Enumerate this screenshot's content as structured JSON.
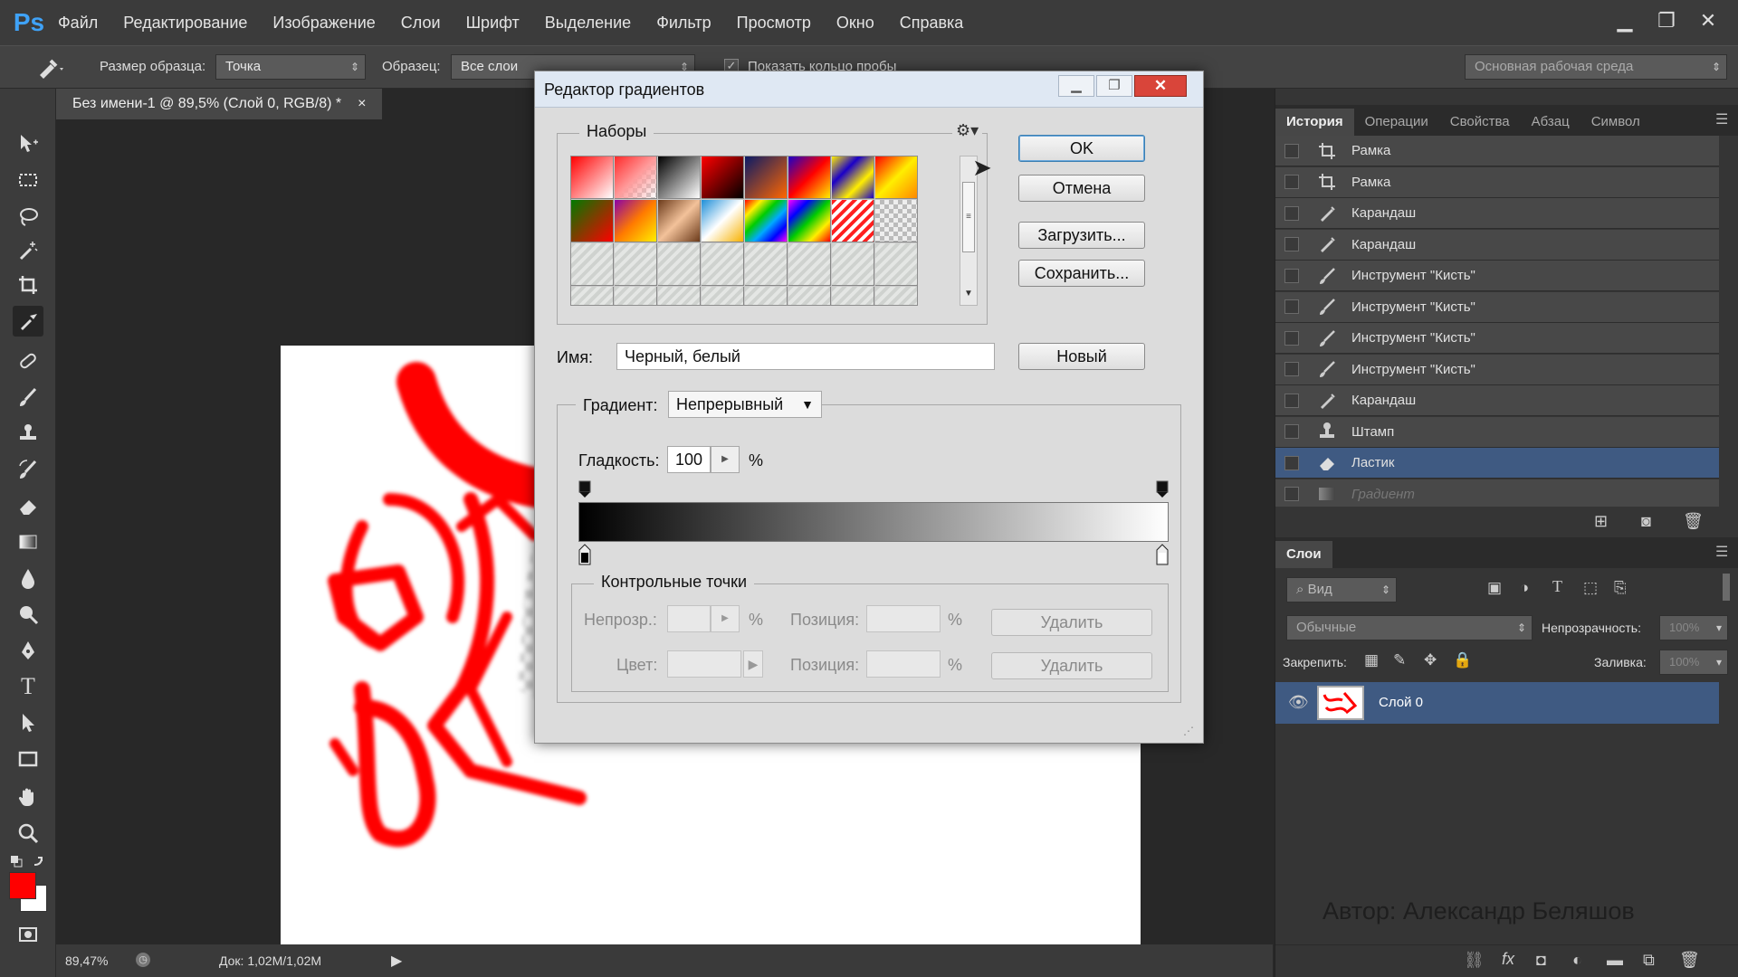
{
  "app": {
    "logo": "Ps"
  },
  "menubar": {
    "items": [
      "Файл",
      "Редактирование",
      "Изображение",
      "Слои",
      "Шрифт",
      "Выделение",
      "Фильтр",
      "Просмотр",
      "Окно",
      "Справка"
    ]
  },
  "options": {
    "sample_size_label": "Размер образца:",
    "sample_size_value": "Точка",
    "sample_label": "Образец:",
    "sample_value": "Все слои",
    "show_ring_label": "Показать кольцо пробы",
    "workspace": "Основная рабочая среда"
  },
  "document": {
    "tab_title": "Без имени-1 @ 89,5% (Слой 0, RGB/8) *",
    "close": "×"
  },
  "colors": {
    "foreground": "#ff0000",
    "background": "#ffffff",
    "accent": "#3fa2f7",
    "selection": "#3f5a82"
  },
  "status": {
    "zoom": "89,47%",
    "doc": "Док: 1,02M/1,02M"
  },
  "history_panel": {
    "tabs": [
      "История",
      "Операции",
      "Свойства",
      "Абзац",
      "Символ"
    ],
    "items": [
      {
        "label": "Рамка",
        "icon": "crop-icon"
      },
      {
        "label": "Рамка",
        "icon": "crop-icon"
      },
      {
        "label": "Карандаш",
        "icon": "pencil-icon"
      },
      {
        "label": "Карандаш",
        "icon": "pencil-icon"
      },
      {
        "label": "Инструмент \"Кисть\"",
        "icon": "brush-icon"
      },
      {
        "label": "Инструмент \"Кисть\"",
        "icon": "brush-icon"
      },
      {
        "label": "Инструмент \"Кисть\"",
        "icon": "brush-icon"
      },
      {
        "label": "Инструмент \"Кисть\"",
        "icon": "brush-icon"
      },
      {
        "label": "Карандаш",
        "icon": "pencil-icon"
      },
      {
        "label": "Штамп",
        "icon": "stamp-icon"
      },
      {
        "label": "Ластик",
        "icon": "eraser-icon",
        "selected": true
      },
      {
        "label": "Градиент",
        "icon": "gradient-icon",
        "dimmed": true
      }
    ]
  },
  "layers_panel": {
    "tab": "Слои",
    "filter": "Вид",
    "blend_mode": "Обычные",
    "opacity_label": "Непрозрачность:",
    "opacity_value": "100%",
    "lock_label": "Закрепить:",
    "fill_label": "Заливка:",
    "fill_value": "100%",
    "layer_name": "Слой 0"
  },
  "watermark": "Автор: Александр Беляшов",
  "dialog": {
    "title": "Редактор градиентов",
    "presets_label": "Наборы",
    "ok": "OK",
    "cancel": "Отмена",
    "load": "Загрузить...",
    "save": "Сохранить...",
    "name_label": "Имя:",
    "name_value": "Черный, белый",
    "new": "Новый",
    "gradient_type_label": "Градиент:",
    "gradient_type_value": "Непрерывный",
    "smoothness_label": "Гладкость:",
    "smoothness_value": "100",
    "percent": "%",
    "stops_label": "Контрольные точки",
    "opacity_label": "Непрозр.:",
    "position_label": "Позиция:",
    "color_label": "Цвет:",
    "delete": "Удалить"
  }
}
